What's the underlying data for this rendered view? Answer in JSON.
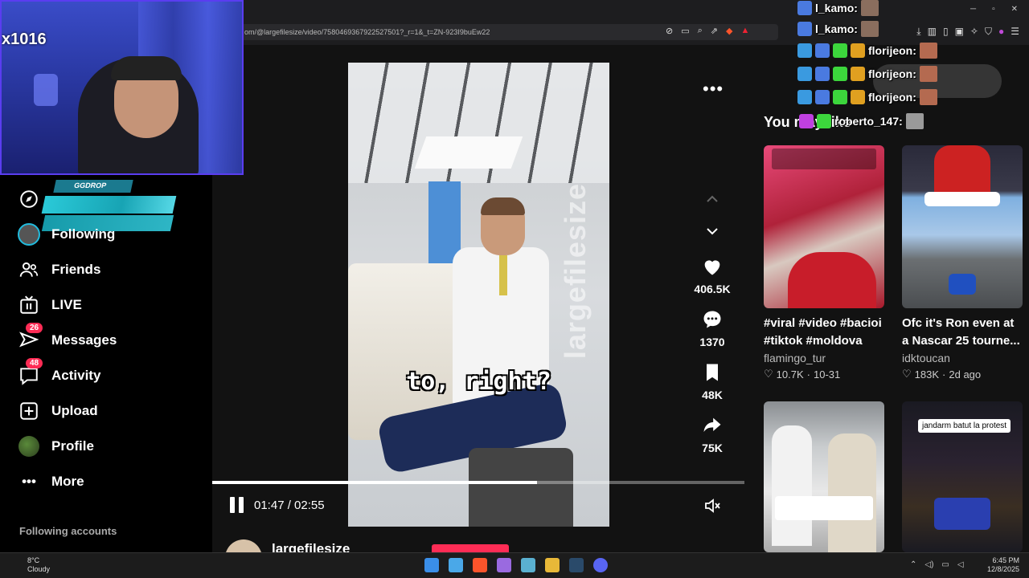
{
  "browser": {
    "url": "om/@largefilesize/video/7580469367922527501?_r=1&_t=ZN-923I9buEw22"
  },
  "webcam": {
    "name_overlay": "x1016"
  },
  "ggdrop": {
    "label": "GGDROP"
  },
  "sidebar": {
    "items": [
      {
        "label": "Following"
      },
      {
        "label": "Friends"
      },
      {
        "label": "LIVE"
      },
      {
        "label": "Messages",
        "badge": "26"
      },
      {
        "label": "Activity",
        "badge": "48"
      },
      {
        "label": "Upload"
      },
      {
        "label": "Profile"
      },
      {
        "label": "More"
      }
    ],
    "section_title": "Following accounts"
  },
  "video": {
    "watermark": "largefilesize",
    "caption": "to, right?",
    "time": "01:47 / 02:55",
    "progress": 0.61,
    "author": "largefilesize"
  },
  "actions": {
    "likes": "406.5K",
    "comments": "1370",
    "saves": "48K",
    "shares": "75K"
  },
  "recommendations": {
    "title": "You may like",
    "cards": [
      {
        "title": "#viral #video #bacioi #tiktok #moldova",
        "author": "flamingo_tur",
        "likes": "10.7K",
        "date": "10-31",
        "overlay": ""
      },
      {
        "title": "Ofc it's Ron even at a Nascar 25 tourne...",
        "author": "idktoucan",
        "likes": "183K",
        "date": "2d ago",
        "overlay": ""
      },
      {
        "title": "",
        "author": "",
        "likes": "",
        "date": "",
        "overlay": ""
      },
      {
        "title": "",
        "author": "",
        "likes": "",
        "date": "",
        "overlay": "jandarm batut la protest"
      }
    ]
  },
  "chat": {
    "lines": [
      {
        "user": "l_kamo:"
      },
      {
        "user": "l_kamo:"
      },
      {
        "user": "florijeon:"
      },
      {
        "user": "florijeon:"
      },
      {
        "user": "florijeon:"
      },
      {
        "user": "roberto_147:"
      }
    ]
  },
  "taskbar": {
    "temp": "8°C",
    "weather": "Cloudy",
    "time": "6:45 PM",
    "date": "12/8/2025"
  },
  "colors": {
    "accent": "#fe2c55",
    "background": "#121212",
    "sidebar": "#000000"
  }
}
